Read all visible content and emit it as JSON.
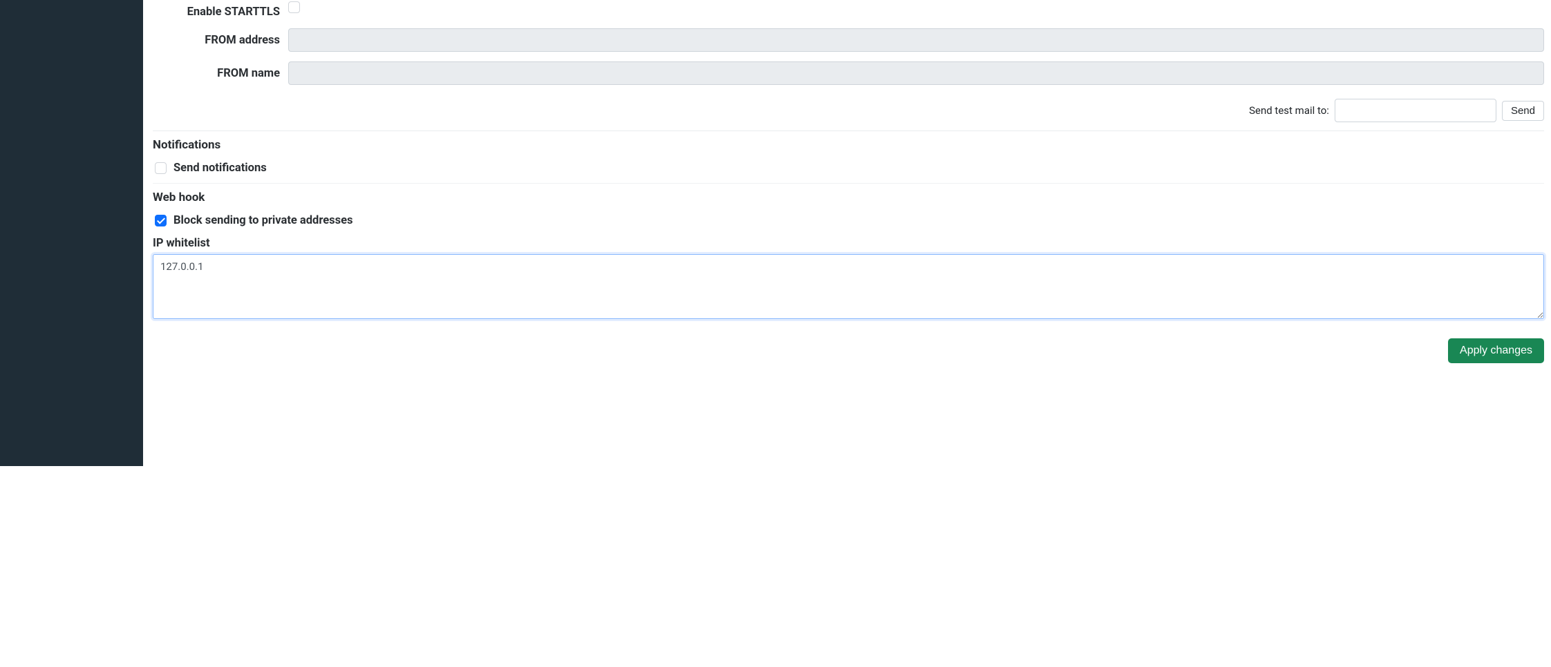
{
  "smtp": {
    "starttls_label": "Enable STARTTLS",
    "starttls_checked": false,
    "from_address_label": "FROM address",
    "from_address_value": "",
    "from_name_label": "FROM name",
    "from_name_value": ""
  },
  "test_mail": {
    "label": "Send test mail to:",
    "value": "",
    "send_button": "Send"
  },
  "notifications": {
    "heading": "Notifications",
    "send_label": "Send notifications",
    "send_checked": false
  },
  "webhook": {
    "heading": "Web hook",
    "block_private_label": "Block sending to private addresses",
    "block_private_checked": true,
    "ip_whitelist_label": "IP whitelist",
    "ip_whitelist_value": "127.0.0.1"
  },
  "actions": {
    "apply_label": "Apply changes"
  }
}
